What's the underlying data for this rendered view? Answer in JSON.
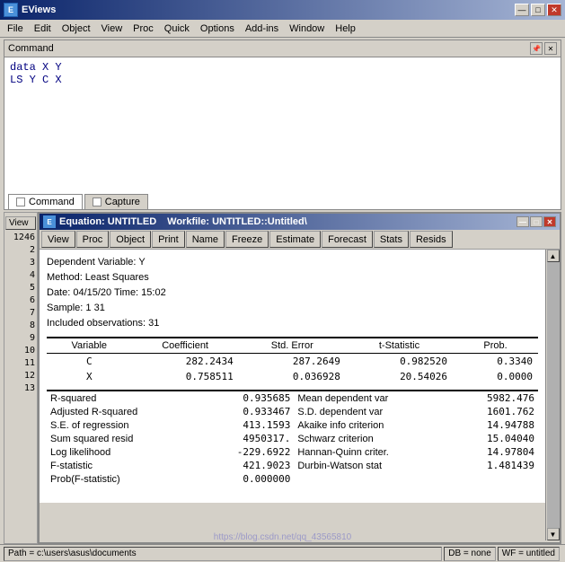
{
  "titlebar": {
    "icon": "E",
    "title": "EViews",
    "minimize": "—",
    "maximize": "□",
    "close": "✕"
  },
  "menubar": {
    "items": [
      "File",
      "Edit",
      "Object",
      "View",
      "Proc",
      "Quick",
      "Options",
      "Add-ins",
      "Window",
      "Help"
    ]
  },
  "command_panel": {
    "title": "Command",
    "pin_icon": "📌",
    "close_icon": "✕",
    "lines": [
      "data  X  Y",
      "LS  Y  C  X"
    ]
  },
  "tabs": [
    {
      "label": "Command"
    },
    {
      "label": "Capture"
    }
  ],
  "equation_window": {
    "title": "Equation: UNTITLED",
    "workfile": "Workfile: UNTITLED::Untitled\\",
    "title_icon": "E",
    "min": "—",
    "max": "□",
    "close": "✕",
    "toolbar": [
      "View",
      "Proc",
      "Object",
      "Print",
      "Name",
      "Freeze",
      "Estimate",
      "Forecast",
      "Stats",
      "Resids"
    ],
    "header": {
      "dependent_var": "Dependent Variable: Y",
      "method": "Method: Least Squares",
      "date": "Date: 04/15/20   Time: 15:02",
      "sample": "Sample: 1 31",
      "observations": "Included observations: 31"
    },
    "columns": [
      "Variable",
      "Coefficient",
      "Std. Error",
      "t-Statistic",
      "Prob."
    ],
    "rows": [
      {
        "var": "C",
        "coef": "282.2434",
        "stderr": "287.2649",
        "tstat": "0.982520",
        "prob": "0.3340"
      },
      {
        "var": "X",
        "coef": "0.758511",
        "stderr": "0.036928",
        "tstat": "20.54026",
        "prob": "0.0000"
      }
    ],
    "stats_left": [
      {
        "label": "R-squared",
        "value": "0.935685"
      },
      {
        "label": "Adjusted R-squared",
        "value": "0.933467"
      },
      {
        "label": "S.E. of regression",
        "value": "413.1593"
      },
      {
        "label": "Sum squared resid",
        "value": "4950317."
      },
      {
        "label": "Log likelihood",
        "value": "-229.6922"
      },
      {
        "label": "F-statistic",
        "value": "421.9023"
      },
      {
        "label": "Prob(F-statistic)",
        "value": "0.000000"
      }
    ],
    "stats_right": [
      {
        "label": "Mean dependent var",
        "value": "5982.476"
      },
      {
        "label": "S.D. dependent var",
        "value": "1601.762"
      },
      {
        "label": "Akaike info criterion",
        "value": "14.94788"
      },
      {
        "label": "Schwarz criterion",
        "value": "15.04040"
      },
      {
        "label": "Hannan-Quinn criter.",
        "value": "14.97804"
      },
      {
        "label": "Durbin-Watson stat",
        "value": "1.481439"
      }
    ]
  },
  "left_panel": {
    "view_label": "View",
    "rows": [
      "1246",
      "2",
      "3",
      "4",
      "5",
      "6",
      "7",
      "8",
      "9",
      "10",
      "11",
      "12",
      "13"
    ]
  },
  "statusbar": {
    "path": "Path = c:\\users\\asus\\documents",
    "db": "DB = none",
    "wf": "WF = untitled"
  },
  "watermark": "https://blog.csdn.net/qq_43565810"
}
